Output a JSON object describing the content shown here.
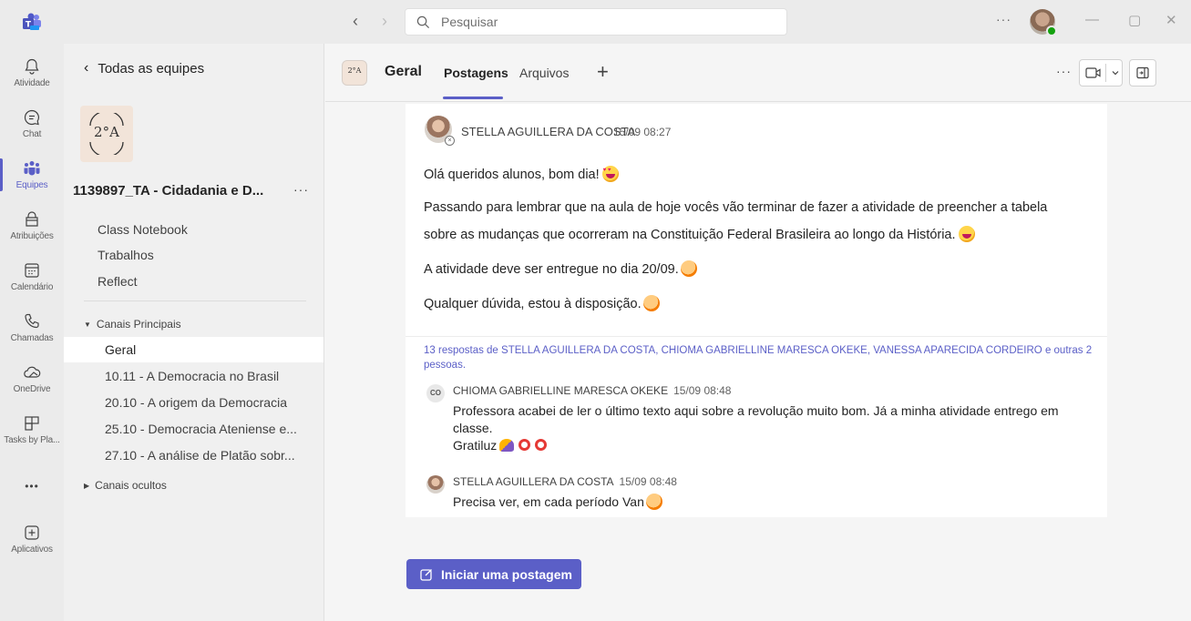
{
  "titlebar": {
    "search_placeholder": "Pesquisar",
    "more": "···",
    "minimize": "—",
    "maximize": "▢",
    "close": "✕"
  },
  "rail": {
    "items": [
      {
        "label": "Atividade",
        "icon": "bell-icon"
      },
      {
        "label": "Chat",
        "icon": "chat-icon"
      },
      {
        "label": "Equipes",
        "icon": "teams-icon",
        "active": true
      },
      {
        "label": "Atribuições",
        "icon": "assignments-icon"
      },
      {
        "label": "Calendário",
        "icon": "calendar-icon"
      },
      {
        "label": "Chamadas",
        "icon": "phone-icon"
      },
      {
        "label": "OneDrive",
        "icon": "cloud-icon"
      },
      {
        "label": "Tasks by Pla...",
        "icon": "tasks-icon"
      },
      {
        "label": "•••",
        "icon": "more-icon"
      },
      {
        "label": "Aplicativos",
        "icon": "apps-icon"
      }
    ]
  },
  "team_panel": {
    "back_label": "Todas as equipes",
    "team_avatar_text": "2°A",
    "team_name": "1139897_TA - Cidadania e D...",
    "team_more": "···",
    "links": [
      "Class Notebook",
      "Trabalhos",
      "Reflect"
    ],
    "section_main": "Canais Principais",
    "channels": [
      "Geral",
      "10.11 - A Democracia no Brasil",
      "20.10 - A origem da Democracia",
      "25.10 - Democracia Ateniense e...",
      "27.10 - A análise de Platão sobr..."
    ],
    "section_hidden": "Canais ocultos"
  },
  "header": {
    "channel_avatar_text": "2°A",
    "channel_title": "Geral",
    "tabs": [
      "Postagens",
      "Arquivos"
    ],
    "add": "+",
    "more": "···"
  },
  "post": {
    "author": "STELLA AGUILLERA DA COSTA",
    "time": "15/09 08:27",
    "lines": [
      "Olá queridos alunos, bom dia!",
      "Passando para lembrar que na aula de hoje vocês vão terminar de fazer a atividade de preencher a tabela",
      "sobre as mudanças que ocorreram na Constituição Federal Brasileira ao longo da História.",
      "A atividade deve ser entregue no dia 20/09.",
      "Qualquer dúvida, estou à disposição."
    ],
    "reply_summary": "13 respostas de STELLA AGUILLERA DA COSTA, CHIOMA GABRIELLINE MARESCA OKEKE, VANESSA APARECIDA CORDEIRO e outras 2 pessoas.",
    "replies": [
      {
        "initials": "CO",
        "author": "CHIOMA GABRIELLINE MARESCA OKEKE",
        "time": "15/09 08:48",
        "text1": "Professora acabei de ler o último texto aqui sobre a revolução muito bom. Já a minha atividade entrego em",
        "text2": "classe.",
        "text3": "Gratiluz"
      },
      {
        "author": "STELLA AGUILLERA DA COSTA",
        "time": "15/09 08:48",
        "text1": "Precisa ver, em cada período Van"
      }
    ]
  },
  "new_post_label": "Iniciar uma postagem"
}
